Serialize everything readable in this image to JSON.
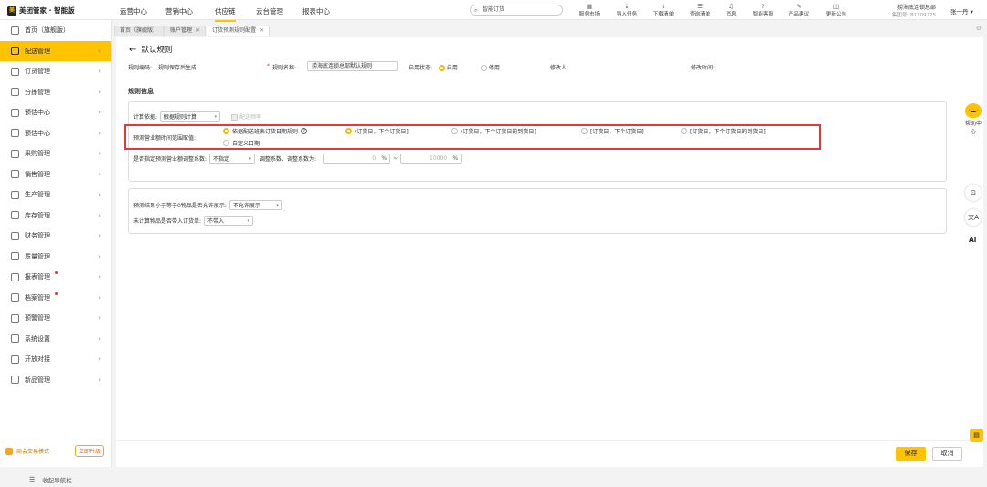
{
  "brand": "美团管家 · 智能版",
  "top_nav": [
    "运营中心",
    "营销中心",
    "供应链",
    "云台管理",
    "报表中心"
  ],
  "top_nav_active": "供应链",
  "search_placeholder": "智能订货",
  "toolbar": [
    {
      "label": "服务市场",
      "icon": "store-icon"
    },
    {
      "label": "导入任务",
      "icon": "import-icon"
    },
    {
      "label": "下载清单",
      "icon": "download-icon"
    },
    {
      "label": "查询清单",
      "icon": "search-list-icon"
    },
    {
      "label": "消息",
      "icon": "bell-icon"
    },
    {
      "label": "智能客服",
      "icon": "service-icon"
    },
    {
      "label": "产品建议",
      "icon": "suggestion-icon"
    },
    {
      "label": "更新公告",
      "icon": "announcement-icon"
    }
  ],
  "shop": {
    "name": "捞海底连锁总部",
    "group": "集团号: 81209275"
  },
  "user": "张一丹 ▾",
  "sidebar": [
    {
      "label": "首页（旗舰版）",
      "icon": "home-icon",
      "arrow": false,
      "dot": false
    },
    {
      "label": "配送管理",
      "icon": "delivery-icon",
      "arrow": true,
      "dot": false,
      "active": true
    },
    {
      "label": "订货管理",
      "icon": "order-icon",
      "arrow": true,
      "dot": false
    },
    {
      "label": "分拣管理",
      "icon": "sorting-icon",
      "arrow": true,
      "dot": false
    },
    {
      "label": "预估中心",
      "icon": "monitor-icon",
      "arrow": true,
      "dot": false
    },
    {
      "label": "预估中心",
      "icon": "monitor-icon",
      "arrow": true,
      "dot": false
    },
    {
      "label": "采购管理",
      "icon": "purchase-icon",
      "arrow": true,
      "dot": false
    },
    {
      "label": "销售管理",
      "icon": "sales-icon",
      "arrow": true,
      "dot": false
    },
    {
      "label": "生产管理",
      "icon": "production-icon",
      "arrow": true,
      "dot": false
    },
    {
      "label": "库存管理",
      "icon": "warehouse-icon",
      "arrow": true,
      "dot": false
    },
    {
      "label": "财务管理",
      "icon": "finance-icon",
      "arrow": true,
      "dot": false
    },
    {
      "label": "质量管理",
      "icon": "quality-icon",
      "arrow": true,
      "dot": false
    },
    {
      "label": "报表管理",
      "icon": "report-icon",
      "arrow": true,
      "dot": true
    },
    {
      "label": "档案管理",
      "icon": "archive-icon",
      "arrow": true,
      "dot": true
    },
    {
      "label": "预警管理",
      "icon": "alert-icon",
      "arrow": true,
      "dot": false
    },
    {
      "label": "系统设置",
      "icon": "settings-icon",
      "arrow": true,
      "dot": false
    },
    {
      "label": "开放对接",
      "icon": "link-icon",
      "arrow": true,
      "dot": false
    },
    {
      "label": "新品管理",
      "icon": "new-product-icon",
      "arrow": true,
      "dot": false
    }
  ],
  "trial": {
    "label": "商会交易模式",
    "button": "立即升级"
  },
  "collapse_label": "收起导航栏",
  "tabs": [
    {
      "label": "首页（旗舰版）",
      "closable": false
    },
    {
      "label": "账户管理",
      "closable": true
    },
    {
      "label": "订货预测规则配置",
      "closable": true,
      "active": true
    }
  ],
  "page_title": "默认规则",
  "meta": {
    "code_label": "规则编码:",
    "code_value": "规则保存后生成",
    "name_label": "规则名称:",
    "name_value": "捞海底连锁总部默认规则",
    "status_label": "启用状态:",
    "status_on": "启用",
    "status_off": "停用",
    "modifier_label": "修改人:",
    "modified_label": "修改时间:"
  },
  "section_title": "规则信息",
  "calc": {
    "label": "计算依据:",
    "value": "根据规则计算",
    "checkbox_label": "配送频率"
  },
  "range": {
    "label": "预测营业额时间范围取值:",
    "options": [
      "依据配送班表订货日期规则",
      "(订货日，下个订货日]",
      "(订货日，下个订货日的到货日]",
      "[订货日，下个订货日]",
      "[订货日，下个订货日的到货日]",
      "自定义日期"
    ],
    "selected": [
      0,
      1
    ]
  },
  "coef": {
    "label": "是否指定预测营业额调整系数:",
    "value": "不指定",
    "adj_label": "调整系数、调整系数为:",
    "min": "0",
    "max": "10000",
    "unit": "%",
    "sep": "~"
  },
  "zero": {
    "label": "预测结果小于等于0物品是否允许展示:",
    "value": "不允许展示"
  },
  "uncalc": {
    "label": "未计算物品是否带入订货单:",
    "value": "不带入"
  },
  "buttons": {
    "save": "保存",
    "cancel": "取消"
  },
  "help_label": "帮助中心",
  "ai_label": "Ai"
}
